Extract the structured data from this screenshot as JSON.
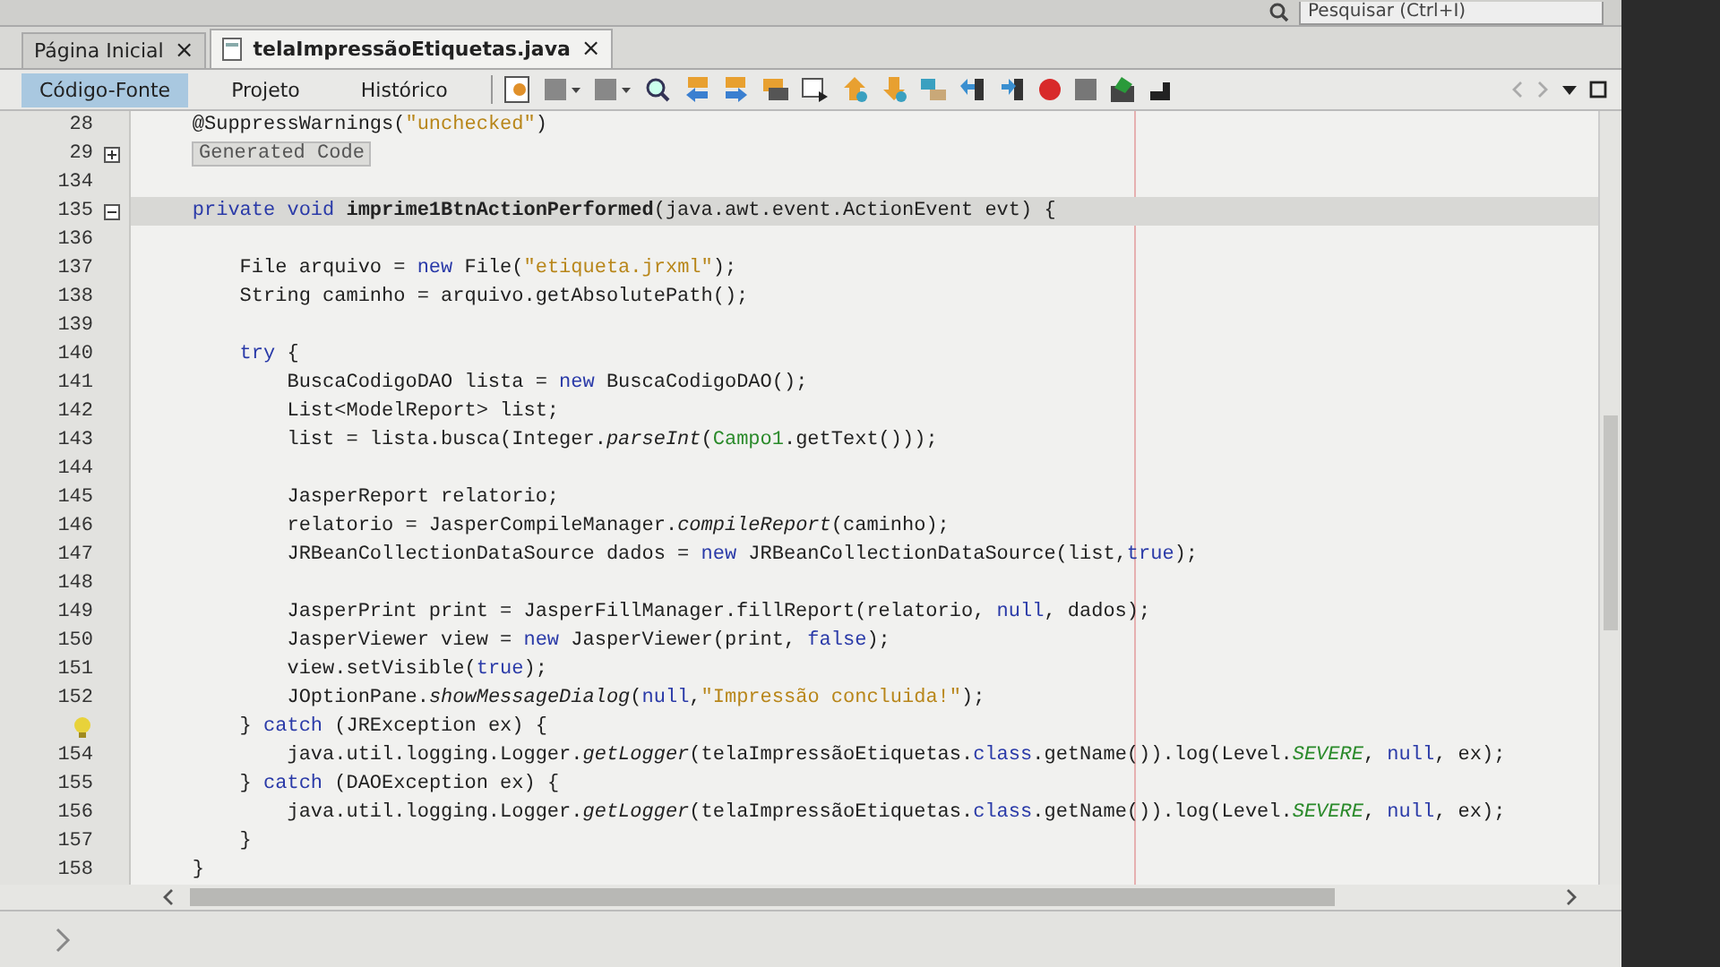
{
  "top_bar": {
    "search": {
      "placeholder": "Pesquisar (Ctrl+I)"
    }
  },
  "tabs": [
    {
      "label": "Página Inicial",
      "close": "×",
      "selected": false
    },
    {
      "label": "telaImpressãoEtiquetas.java",
      "close": "×",
      "selected": true
    }
  ],
  "view_tabs": [
    {
      "label": "Código-Fonte",
      "selected": true
    },
    {
      "label": "Projeto",
      "selected": false
    },
    {
      "label": "Histórico",
      "selected": false
    }
  ],
  "editor": {
    "lines": [
      {
        "number": "28",
        "kind": "code",
        "current": false,
        "tokens": [
          {
            "kind": "plain",
            "text": "    @SuppressWarnings("
          },
          {
            "kind": "string",
            "text": "\"unchecked\""
          },
          {
            "kind": "plain",
            "text": ")"
          }
        ]
      },
      {
        "number": "29",
        "kind": "fold",
        "current": false,
        "collapsed": true,
        "text": "Generated Code"
      },
      {
        "number": "134",
        "kind": "code",
        "current": false
      },
      {
        "number": "135",
        "kind": "code",
        "current": true,
        "collapsed": false,
        "tokens": [
          {
            "kind": "keyword",
            "text": "    private void "
          },
          {
            "kind": "bold",
            "text": "imprime1BtnActionPerformed"
          },
          {
            "kind": "plain",
            "text": "(java.awt.event.ActionEvent evt) {"
          }
        ]
      },
      {
        "number": "136",
        "kind": "code",
        "current": false
      },
      {
        "number": "137",
        "kind": "code",
        "current": false,
        "tokens": [
          {
            "kind": "plain",
            "text": "        File arquivo = "
          },
          {
            "kind": "keyword",
            "text": "new"
          },
          {
            "kind": "plain",
            "text": " File("
          },
          {
            "kind": "string",
            "text": "\"etiqueta.jrxml\""
          },
          {
            "kind": "plain",
            "text": ");"
          }
        ]
      },
      {
        "number": "138",
        "kind": "code",
        "current": false,
        "tokens": [
          {
            "kind": "plain",
            "text": "        String caminho = arquivo.getAbsolutePath();"
          }
        ]
      },
      {
        "number": "139",
        "kind": "code",
        "current": false
      },
      {
        "number": "140",
        "kind": "code",
        "current": false,
        "tokens": [
          {
            "kind": "keyword",
            "text": "        try"
          },
          {
            "kind": "plain",
            "text": " {"
          }
        ]
      },
      {
        "number": "141",
        "kind": "code",
        "current": false,
        "tokens": [
          {
            "kind": "plain",
            "text": "            BuscaCodigoDAO lista = "
          },
          {
            "kind": "keyword",
            "text": "new"
          },
          {
            "kind": "plain",
            "text": " BuscaCodigoDAO();"
          }
        ]
      },
      {
        "number": "142",
        "kind": "code",
        "current": false,
        "tokens": [
          {
            "kind": "plain",
            "text": "            List<ModelReport> list;"
          }
        ]
      },
      {
        "number": "143",
        "kind": "code",
        "current": false,
        "tokens": [
          {
            "kind": "plain",
            "text": "            list = lista.busca(Integer."
          },
          {
            "kind": "italic",
            "text": "parseInt"
          },
          {
            "kind": "plain",
            "text": "("
          },
          {
            "kind": "field",
            "text": "Campo1"
          },
          {
            "kind": "plain",
            "text": ".getText()));"
          }
        ]
      },
      {
        "number": "144",
        "kind": "code",
        "current": false
      },
      {
        "number": "145",
        "kind": "code",
        "current": false,
        "tokens": [
          {
            "kind": "plain",
            "text": "            JasperReport relatorio;"
          }
        ]
      },
      {
        "number": "146",
        "kind": "code",
        "current": false,
        "tokens": [
          {
            "kind": "plain",
            "text": "            relatorio = JasperCompileManager."
          },
          {
            "kind": "italic",
            "text": "compileReport"
          },
          {
            "kind": "plain",
            "text": "(caminho);"
          }
        ]
      },
      {
        "number": "147",
        "kind": "code",
        "current": false,
        "tokens": [
          {
            "kind": "plain",
            "text": "            JRBeanCollectionDataSource dados = "
          },
          {
            "kind": "keyword",
            "text": "new"
          },
          {
            "kind": "plain",
            "text": " JRBeanCollectionDataSource(list,"
          },
          {
            "kind": "keyword",
            "text": "true"
          },
          {
            "kind": "plain",
            "text": ");"
          }
        ]
      },
      {
        "number": "148",
        "kind": "code",
        "current": false
      },
      {
        "number": "149",
        "kind": "code",
        "current": false,
        "tokens": [
          {
            "kind": "plain",
            "text": "            JasperPrint print = JasperFillManager.fillReport(relatorio, "
          },
          {
            "kind": "keyword",
            "text": "null"
          },
          {
            "kind": "plain",
            "text": ", dados);"
          }
        ]
      },
      {
        "number": "150",
        "kind": "code",
        "current": false,
        "tokens": [
          {
            "kind": "plain",
            "text": "            JasperViewer view = "
          },
          {
            "kind": "keyword",
            "text": "new"
          },
          {
            "kind": "plain",
            "text": " JasperViewer(print, "
          },
          {
            "kind": "keyword",
            "text": "false"
          },
          {
            "kind": "plain",
            "text": ");"
          }
        ]
      },
      {
        "number": "151",
        "kind": "code",
        "current": false,
        "tokens": [
          {
            "kind": "plain",
            "text": "            view.setVisible("
          },
          {
            "kind": "keyword",
            "text": "true"
          },
          {
            "kind": "plain",
            "text": ");"
          }
        ]
      },
      {
        "number": "152",
        "kind": "code",
        "current": false,
        "tokens": [
          {
            "kind": "plain",
            "text": "            JOptionPane."
          },
          {
            "kind": "italic",
            "text": "showMessageDialog"
          },
          {
            "kind": "plain",
            "text": "("
          },
          {
            "kind": "keyword",
            "text": "null"
          },
          {
            "kind": "plain",
            "text": ","
          },
          {
            "kind": "string",
            "text": "\"Impressão concluida!\""
          },
          {
            "kind": "plain",
            "text": ");"
          }
        ]
      },
      {
        "kind": "hint",
        "current": false,
        "tokens": [
          {
            "kind": "plain",
            "text": "        } "
          },
          {
            "kind": "keyword",
            "text": "catch"
          },
          {
            "kind": "plain",
            "text": " (JRException ex) {"
          }
        ]
      },
      {
        "number": "154",
        "kind": "code",
        "current": false,
        "tokens": [
          {
            "kind": "plain",
            "text": "            java.util.logging.Logger."
          },
          {
            "kind": "italic",
            "text": "getLogger"
          },
          {
            "kind": "plain",
            "text": "(telaImpressãoEtiquetas."
          },
          {
            "kind": "keyword",
            "text": "class"
          },
          {
            "kind": "plain",
            "text": ".getName()).log(Level."
          },
          {
            "kind": "field_italic",
            "text": "SEVERE"
          },
          {
            "kind": "plain",
            "text": ", "
          },
          {
            "kind": "keyword",
            "text": "null"
          },
          {
            "kind": "plain",
            "text": ", ex);"
          }
        ]
      },
      {
        "number": "155",
        "kind": "code",
        "current": false,
        "tokens": [
          {
            "kind": "plain",
            "text": "        } "
          },
          {
            "kind": "keyword",
            "text": "catch"
          },
          {
            "kind": "plain",
            "text": " (DAOException ex) {"
          }
        ]
      },
      {
        "number": "156",
        "kind": "code",
        "current": false,
        "tokens": [
          {
            "kind": "plain",
            "text": "            java.util.logging.Logger."
          },
          {
            "kind": "italic",
            "text": "getLogger"
          },
          {
            "kind": "plain",
            "text": "(telaImpressãoEtiquetas."
          },
          {
            "kind": "keyword",
            "text": "class"
          },
          {
            "kind": "plain",
            "text": ".getName()).log(Level."
          },
          {
            "kind": "field_italic",
            "text": "SEVERE"
          },
          {
            "kind": "plain",
            "text": ", "
          },
          {
            "kind": "keyword",
            "text": "null"
          },
          {
            "kind": "plain",
            "text": ", ex);"
          }
        ]
      },
      {
        "number": "157",
        "kind": "code",
        "current": false,
        "tokens": [
          {
            "kind": "plain",
            "text": "        }"
          }
        ]
      },
      {
        "number": "158",
        "kind": "code",
        "current": false,
        "tokens": [
          {
            "kind": "plain",
            "text": "    }"
          }
        ]
      }
    ]
  }
}
